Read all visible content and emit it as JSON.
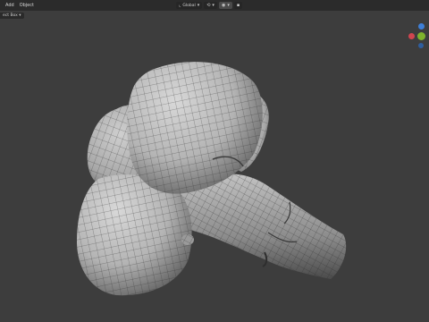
{
  "menu": {
    "add": "Add",
    "object": "Object"
  },
  "toolbar": {
    "transform_orientation": "Global"
  },
  "mode": {
    "select_box": "ect Box ▾"
  },
  "colors": {
    "viewport_bg": "#3d3d3d",
    "header_bg": "#2b2b2b",
    "axis_x": "#d0454f",
    "axis_y": "#7fb32d",
    "axis_z": "#3e7fd7"
  },
  "icons": [
    "transform-pivot-icon",
    "snap-icon",
    "proportional-edit-icon",
    "chevron-down-icon",
    "gizmo-axis-icons"
  ]
}
